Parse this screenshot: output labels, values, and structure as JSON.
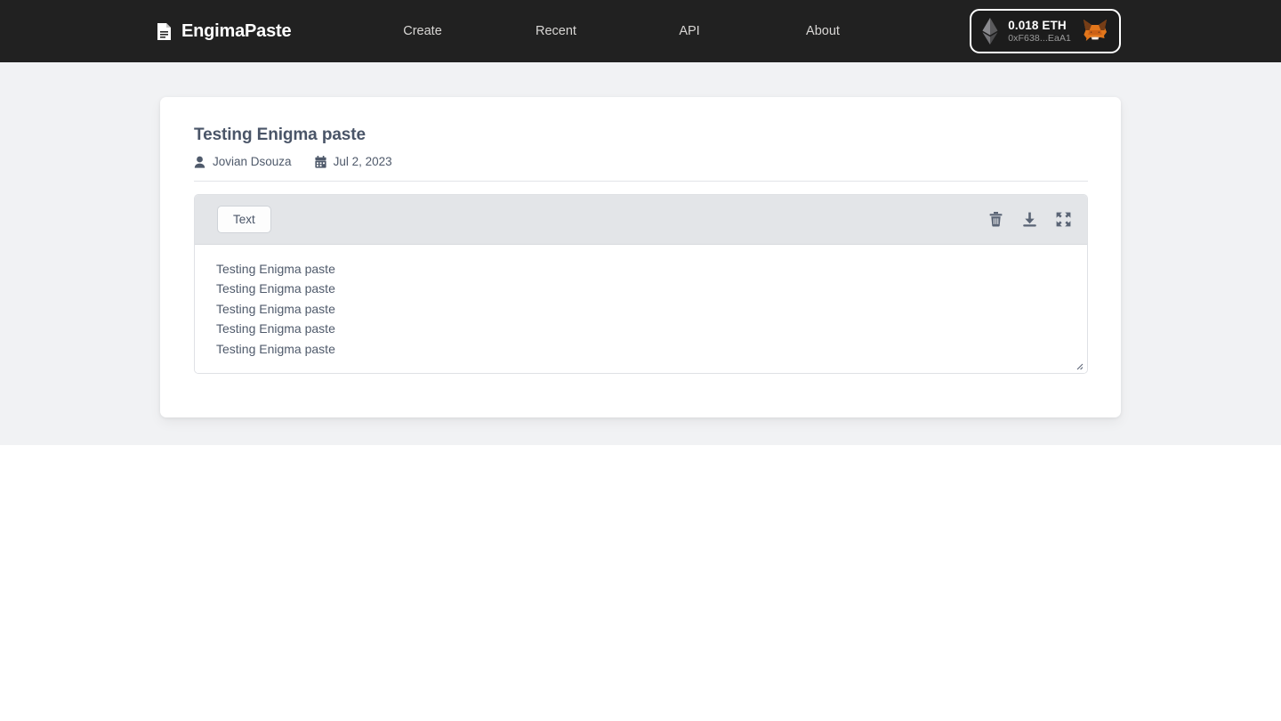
{
  "header": {
    "brand": "EngimaPaste",
    "brand_icon": "document-icon",
    "nav": [
      {
        "label": "Create"
      },
      {
        "label": "Recent"
      },
      {
        "label": "API"
      },
      {
        "label": "About"
      }
    ],
    "wallet": {
      "balance": "0.018 ETH",
      "address": "0xF638...EaA1",
      "chain_icon": "ethereum-icon",
      "provider_icon": "metamask-fox-icon"
    },
    "background_color": "#212121"
  },
  "paste": {
    "title": "Testing Enigma paste",
    "author": "Jovian Dsouza",
    "author_icon": "user-icon",
    "date": "Jul 2, 2023",
    "date_icon": "calendar-icon",
    "editor": {
      "type_label": "Text",
      "actions": [
        {
          "name": "delete",
          "icon": "trash-icon"
        },
        {
          "name": "download",
          "icon": "download-icon"
        },
        {
          "name": "fullscreen",
          "icon": "expand-icon"
        }
      ],
      "content_lines": [
        "Testing Enigma paste",
        "Testing Enigma paste",
        "Testing Enigma paste",
        "Testing Enigma paste",
        "Testing Enigma paste"
      ]
    }
  },
  "theme": {
    "page_background": "#f1f2f4",
    "card_background": "#ffffff",
    "toolbar_background": "#e3e5e8",
    "text_color": "#4f5a6b",
    "accent": "#e8833a"
  }
}
